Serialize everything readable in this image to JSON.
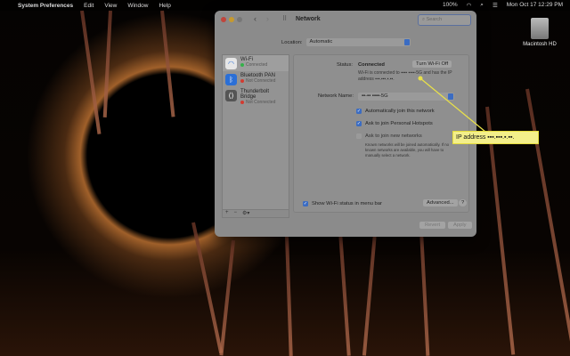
{
  "menubar": {
    "app": "System Preferences",
    "items": [
      "Edit",
      "View",
      "Window",
      "Help"
    ],
    "battery": "100%",
    "datetime": "Mon Oct 17  12:29 PM"
  },
  "desktop": {
    "drive_label": "Macintosh HD"
  },
  "window": {
    "title": "Network",
    "search_placeholder": "Search",
    "location_label": "Location:",
    "location_value": "Automatic",
    "services": [
      {
        "name": "Wi-Fi",
        "status": "Connected",
        "status_color": "#35b14a",
        "icon": "wifi-icon"
      },
      {
        "name": "Bluetooth PAN",
        "status": "Not Connected",
        "status_color": "#d23b30",
        "icon": "bluetooth-icon"
      },
      {
        "name": "Thunderbolt Bridge",
        "status": "Not Connected",
        "status_color": "#d23b30",
        "icon": "thunderbolt-icon"
      }
    ],
    "list_buttons": [
      "+",
      "−",
      "⚙▾"
    ],
    "status_label": "Status:",
    "status_value": "Connected",
    "turn_off": "Turn Wi-Fi Off",
    "status_desc": "Wi-Fi is connected to ▪▪▪▪ ▪▪▪▪-5G and has the IP address ▪▪▪.▪▪▪.▪.▪▪.",
    "network_name_label": "Network Name:",
    "network_name_value": "▪▪-▪▪ ▪▪▪▪-5G",
    "options": [
      {
        "label": "Automatically join this network",
        "checked": true
      },
      {
        "label": "Ask to join Personal Hotspots",
        "checked": true
      },
      {
        "label": "Ask to join new networks",
        "checked": false
      }
    ],
    "note": "Known networks will be joined automatically. If no known networks are available, you will have to manually select a network.",
    "show_status": "Show Wi-Fi status in menu bar",
    "advanced": "Advanced...",
    "help": "?",
    "revert": "Revert",
    "apply": "Apply"
  },
  "callout": "IP address ▪▪▪.▪▪▪.▪.▪▪."
}
